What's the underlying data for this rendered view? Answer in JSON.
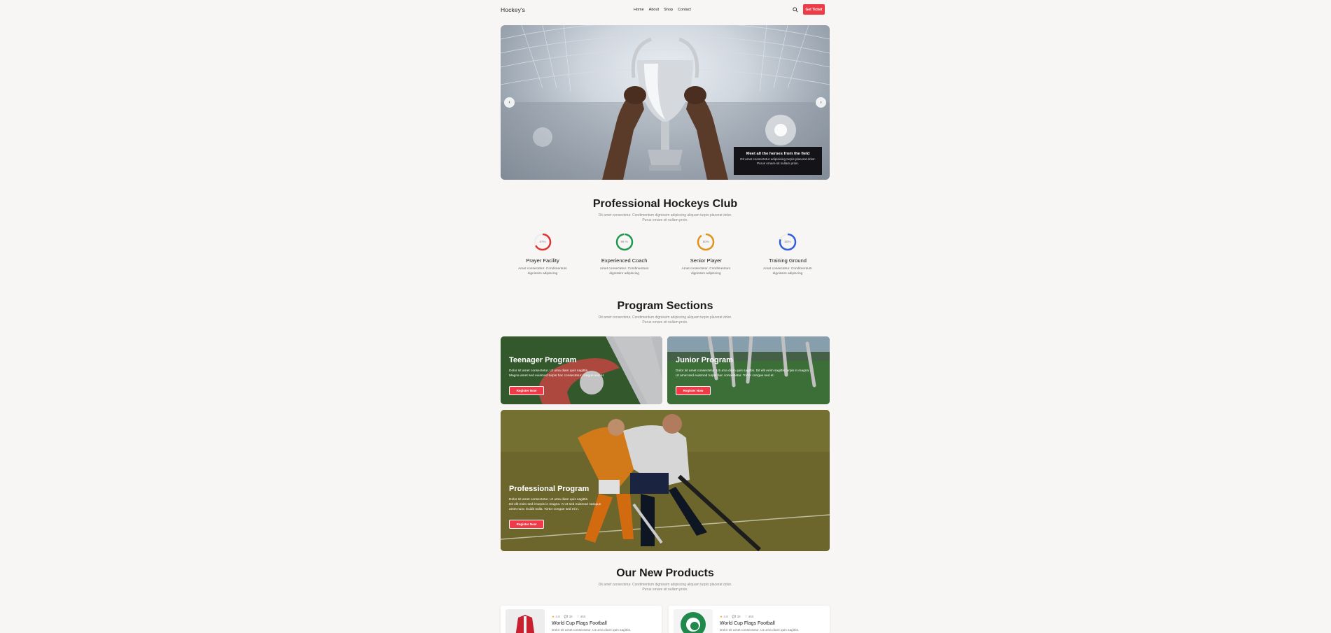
{
  "nav": {
    "logo": "Hockey's",
    "links": [
      "Home",
      "About",
      "Shop",
      "Contact"
    ],
    "cta": "Get Ticket"
  },
  "hero": {
    "caption_title": "Meet all the heroes from the field",
    "caption_text": "Dit amet consectetur adipisicing turpis placerat dolor. Purus ornare sit nullam proin."
  },
  "club": {
    "title": "Professional Hockeys Club",
    "subtitle_1": "Dit amet consectetur. Condimentum dignissim adipiscing aliquam turpis placerat dolor.",
    "subtitle_2": "Purus ornare sit nullam proin.",
    "stats": [
      {
        "label": "Prayer Facility",
        "percent_text": "67%",
        "value": 67,
        "color": "#e0322f",
        "desc_1": "Amet consectetur. Condimentum",
        "desc_2": "dignissim adipiscing"
      },
      {
        "label": "Experienced Coach",
        "percent_text": "98 %",
        "value": 98,
        "color": "#1e9a4f",
        "desc_1": "Amet consectetur. Condimentum",
        "desc_2": "dignissim adipiscing"
      },
      {
        "label": "Senior Player",
        "percent_text": "90%",
        "value": 90,
        "color": "#e0921a",
        "desc_1": "Amet consectetur. Condimentum",
        "desc_2": "dignissim adipiscing"
      },
      {
        "label": "Training Ground",
        "percent_text": "80%",
        "value": 80,
        "color": "#2f5fe0",
        "desc_1": "Amet consectetur. Condimentum",
        "desc_2": "dignissim adipiscing"
      }
    ]
  },
  "programs": {
    "title": "Program Sections",
    "subtitle_1": "Dit amet consectetur. Condimentum dignissim adipiscing aliquam turpis placerat dolor.",
    "subtitle_2": "Purus ornare sit nullam proin.",
    "button": "Register Now",
    "teen": {
      "title": "Teenager Program",
      "desc_1": "Dolor sit amet consectetur. Ut urna diam quis sagittis.",
      "desc_2": "Magna amet sed euismod turpis hac consectetur congue sed et."
    },
    "junior": {
      "title": "Junior Program",
      "desc_1": "Dolor sit amet consectetur. Ut urna diam quis sagittis. Dit elit enim sagittis turpis in magna.",
      "desc_2": "Ut amet sed euismod turpis hac consectetur. Tortor congue sed et."
    },
    "pro": {
      "title": "Professional Program",
      "desc_1": "Dolor sit amet consectetur. Ut urna diam quis sagittis.",
      "desc_2": "Dit elit enim sed it turpis in magna. At et sed euismod natoque",
      "desc_3": "amet nunc incidit nulla. Tortor congue sed et in."
    }
  },
  "products": {
    "title": "Our New Products",
    "subtitle_1": "Dit amet consectetur. Condimentum dignissim adipiscing aliquam turpis placerat dolor.",
    "subtitle_2": "Purus ornare sit nullam proin.",
    "items": [
      {
        "rating": "4.9",
        "comments": "30",
        "likes": "450",
        "name": "World Cup Flags Football",
        "desc": "Dolor sit amet consectetur. Ut urna diam quis sagittis."
      },
      {
        "rating": "4.9",
        "comments": "30",
        "likes": "450",
        "name": "World Cup Flags Football",
        "desc": "Dolor sit amet consectetur. Ut urna diam quis sagittis."
      }
    ]
  }
}
